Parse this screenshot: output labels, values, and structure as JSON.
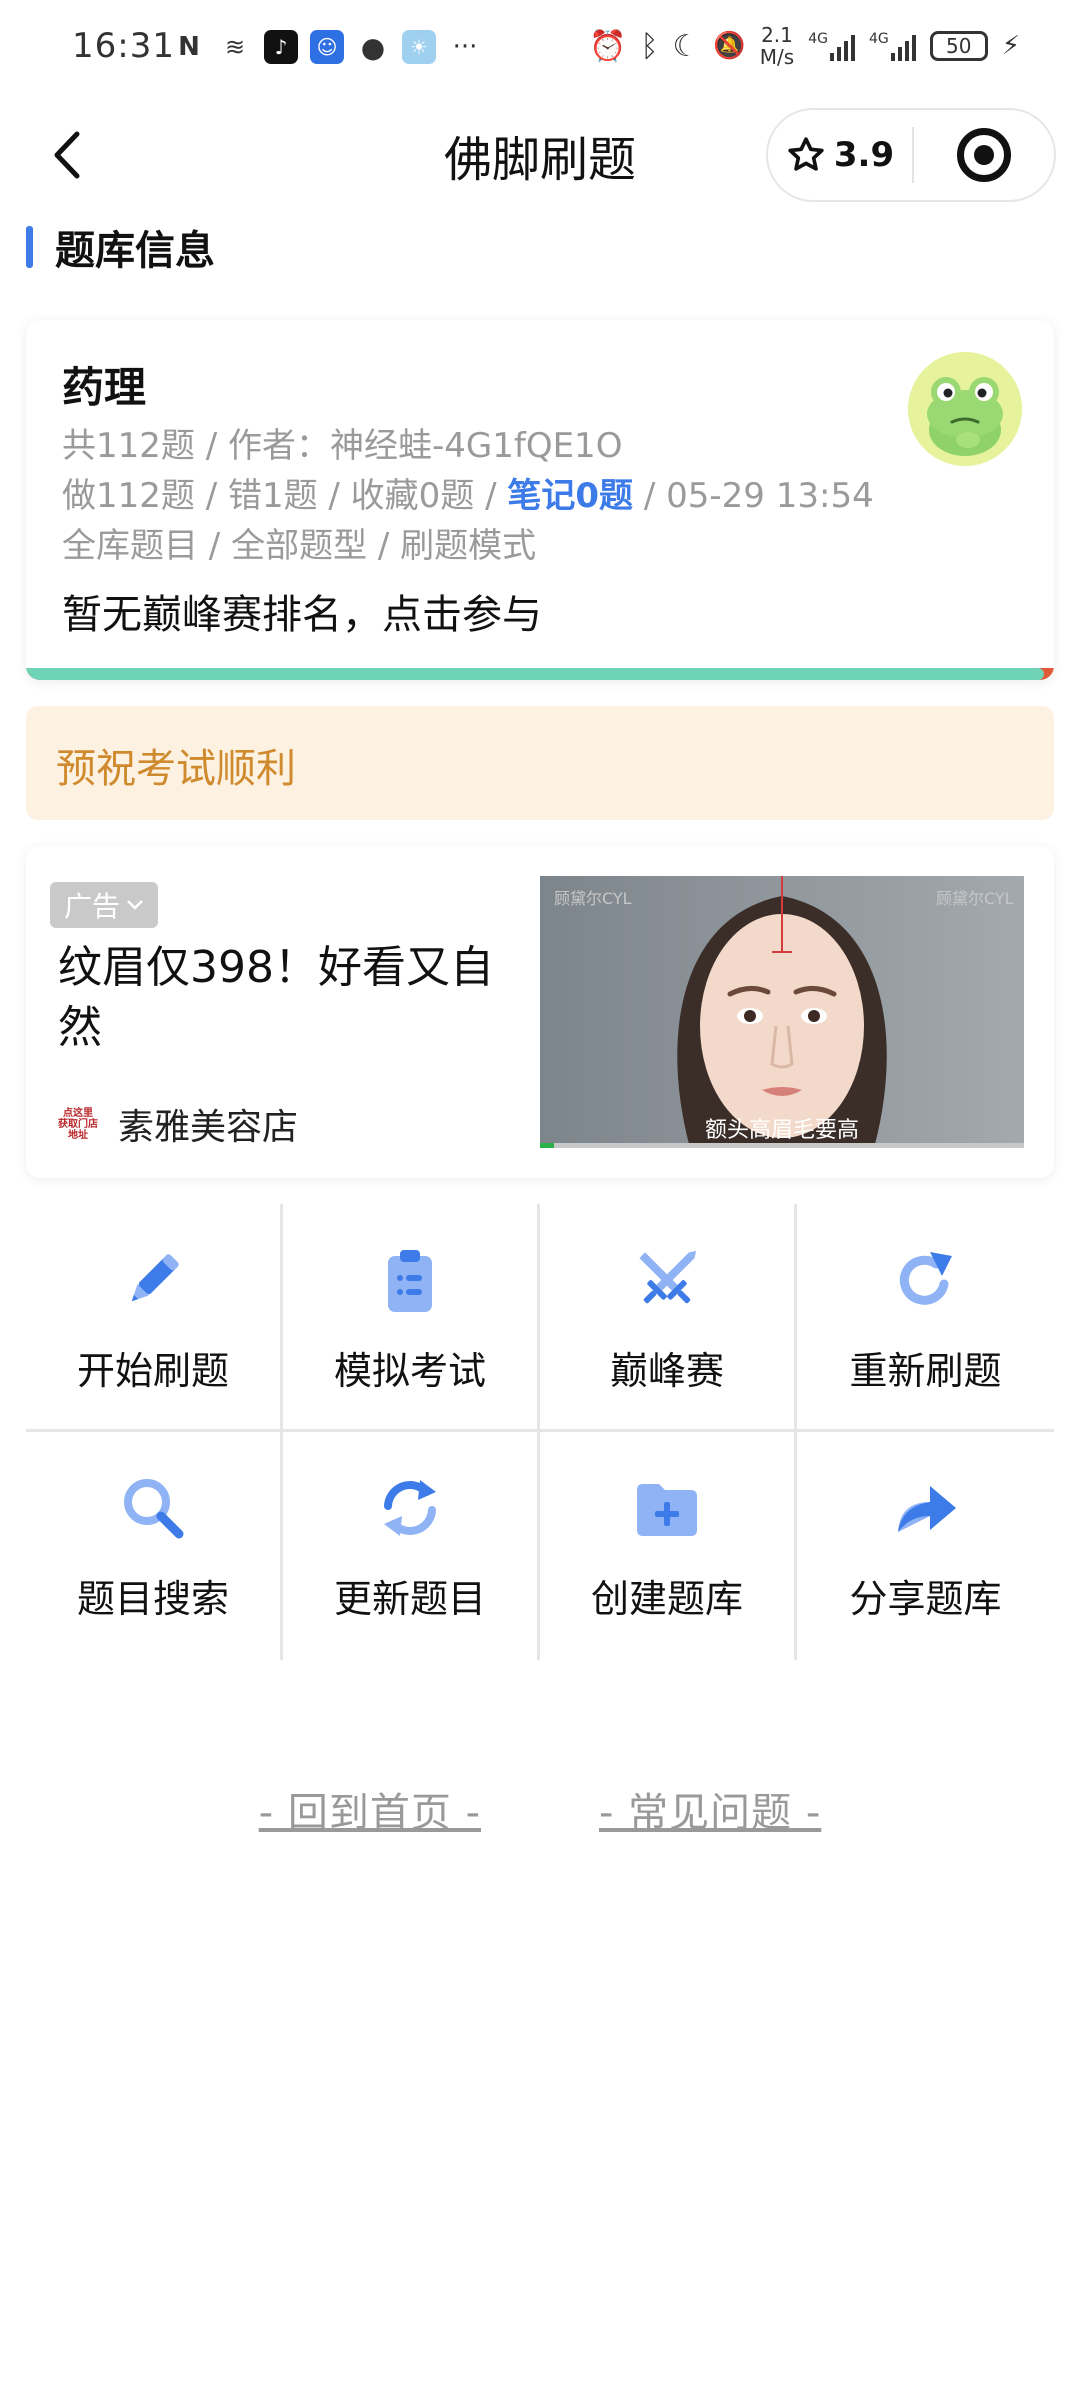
{
  "status_bar": {
    "time": "16:31",
    "net_speed_value": "2.1",
    "net_speed_unit": "M/s",
    "battery": "50",
    "more_icon": "···"
  },
  "nav": {
    "title": "佛脚刷题",
    "rating": "3.9"
  },
  "section": {
    "title": "题库信息"
  },
  "info_card": {
    "title": "药理",
    "line1": "共112题 / 作者：神经蛙-4G1fQE1O",
    "line2_prefix": "做112题 / 错1题 / 收藏0题 / ",
    "line2_highlight": "笔记0题",
    "line2_suffix": " / 05-29 13:54",
    "line3": "全库题目 / 全部题型 / 刷题模式",
    "rank_text": "暂无巅峰赛排名，点击参与",
    "progress": 0.99
  },
  "wish": {
    "text": "预祝考试顺利"
  },
  "ad": {
    "badge": "广告",
    "title": "纹眉仅398！好看又自然",
    "logo_lines": [
      "点这里",
      "获取门店",
      "地址"
    ],
    "shop_name": "素雅美容店",
    "media_caption": "额头高眉毛要高",
    "media_watermark": "顾黛尔CYL"
  },
  "grid": [
    {
      "label": "开始刷题",
      "icon": "pencil-icon"
    },
    {
      "label": "模拟考试",
      "icon": "clipboard-icon"
    },
    {
      "label": "巅峰赛",
      "icon": "crossed-swords-icon"
    },
    {
      "label": "重新刷题",
      "icon": "redo-icon"
    },
    {
      "label": "题目搜索",
      "icon": "search-icon"
    },
    {
      "label": "更新题目",
      "icon": "refresh-icon"
    },
    {
      "label": "创建题库",
      "icon": "folder-plus-icon"
    },
    {
      "label": "分享题库",
      "icon": "share-icon"
    }
  ],
  "footer": {
    "home": "- 回到首页 -",
    "faq": "- 常见问题 -"
  },
  "colors": {
    "accent": "#3d7be8",
    "icon_light": "#8fb3f5",
    "wish_bg": "#fdf1e2",
    "wish_text": "#d08a2e",
    "progress_fill": "#6fd3b6",
    "progress_end": "#e05a3a"
  }
}
